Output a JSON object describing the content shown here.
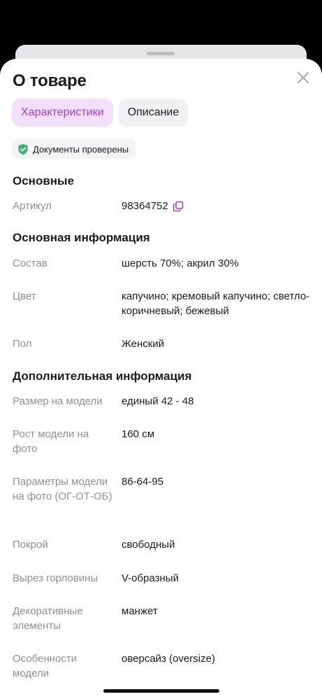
{
  "sheet": {
    "title": "О товаре",
    "tabs": [
      {
        "label": "Характеристики",
        "active": true
      },
      {
        "label": "Описание",
        "active": false
      }
    ],
    "badge": "Документы проверены"
  },
  "sections": {
    "basic": {
      "title": "Основные",
      "article": {
        "key": "Артикул",
        "value": "98364752"
      }
    },
    "main_info": {
      "title": "Основная информация",
      "rows": [
        {
          "key": "Состав",
          "value": "шерсть 70%; акрил 30%"
        },
        {
          "key": "Цвет",
          "value": "капучино; кремовый капучино; светло-коричневый; бежевый"
        },
        {
          "key": "Пол",
          "value": "Женский"
        }
      ]
    },
    "extra_info": {
      "title": "Дополнительная информация",
      "rows": [
        {
          "key": "Размер на модели",
          "value": "единый 42 - 48"
        },
        {
          "key": "Рост модели на фото",
          "value": "160 см"
        },
        {
          "key": "Параметры модели на фото (ОГ-ОТ-ОБ)",
          "value": "86-64-95"
        },
        {
          "key": "Покрой",
          "value": "свободный"
        },
        {
          "key": "Вырез горловины",
          "value": "V-образный"
        },
        {
          "key": "Декоративные элементы",
          "value": "манжет"
        },
        {
          "key": "Особенности модели",
          "value": "оверсайз (oversize)"
        }
      ]
    }
  },
  "colors": {
    "accent": "#a23bd6",
    "accent_bg": "#f1dffb",
    "verified_green": "#3cb371"
  }
}
